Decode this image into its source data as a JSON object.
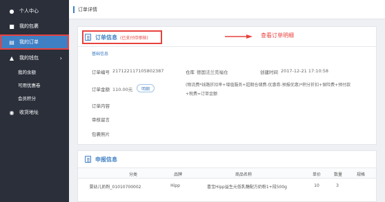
{
  "sidebar": {
    "items": [
      {
        "label": "个人中心",
        "icon": "user-icon"
      },
      {
        "label": "我的包裹",
        "icon": "package-icon"
      },
      {
        "label": "我的订单",
        "icon": "order-icon"
      },
      {
        "label": "我的钱包",
        "icon": "wallet-icon"
      },
      {
        "label": "收货地址",
        "icon": "location-pin-icon"
      }
    ],
    "wallet_arrow": "›",
    "sub_items": [
      "我的余额",
      "可用优惠卷",
      "会员积分"
    ]
  },
  "header": {
    "title": "订单详情"
  },
  "order_info": {
    "title": "订单信息",
    "status": "(已支付待审核)",
    "callout": "查看订单明细",
    "subheading": "基础信息",
    "order_no_label": "订单编号",
    "order_no": "217122117105802387",
    "warehouse_label": "仓库",
    "warehouse": "德国法兰克福仓",
    "created_label": "创建时间",
    "created": "2017-12-21 17:10:58",
    "amount_label": "订单金额",
    "amount": "110.00元",
    "detail_button": "明细",
    "formula_line1": "(物流费*线路折扣率+增值服务+超期仓储费-优惠券-预报优惠)*积分折扣+保险费+预付款",
    "formula_line2": "+税费=订单金额",
    "content_label": "订单内容",
    "remark_label": "审核留言",
    "photo_label": "包裹照片"
  },
  "declaration": {
    "title": "申报信息",
    "columns": [
      "分类",
      "品牌",
      "商品名称",
      "单价",
      "数量",
      "规格"
    ],
    "rows": [
      {
        "category": "婴幼儿奶粉_01010700002",
        "brand": "Hipp",
        "name": "喜宝Hipp益生元低乳糖配方奶粉1+段500g",
        "price": "10",
        "qty": "3",
        "spec": ""
      }
    ]
  },
  "colors": {
    "accent": "#3f7fc4",
    "highlight": "#e8413d",
    "sidebar": "#2a2f3a"
  }
}
